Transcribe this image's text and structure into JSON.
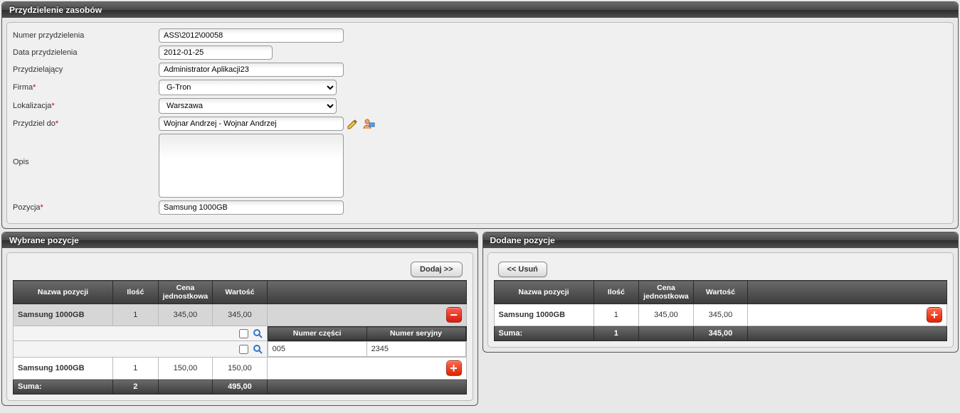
{
  "alloc": {
    "header": "Przydzielenie zasobów",
    "labels": {
      "number": "Numer przydzielenia",
      "date": "Data przydzielenia",
      "assigner": "Przydzielający",
      "company": "Firma",
      "location": "Lokalizacja",
      "assignTo": "Przydziel do",
      "desc": "Opis",
      "position": "Pozycja"
    },
    "values": {
      "number": "ASS\\2012\\00058",
      "date": "2012-01-25",
      "assigner": "Administrator Aplikacji23",
      "company": "G-Tron",
      "location": "Warszawa",
      "assignTo": "Wojnar Andrzej - Wojnar Andrzej",
      "desc": "",
      "position": "Samsung 1000GB"
    }
  },
  "left": {
    "header": "Wybrane pozycje",
    "addBtn": "Dodaj >>",
    "columns": {
      "name": "Nazwa pozycji",
      "qty": "Ilość",
      "unitPrice": "Cena jednostkowa",
      "value": "Wartość"
    },
    "rows": [
      {
        "name": "Samsung 1000GB",
        "qty": "1",
        "unitPrice": "345,00",
        "value": "345,00",
        "action": "minus",
        "selected": true
      },
      {
        "name": "Samsung 1000GB",
        "qty": "1",
        "unitPrice": "150,00",
        "value": "150,00",
        "action": "plus",
        "selected": false
      }
    ],
    "detailCols": {
      "partNo": "Numer części",
      "serialNo": "Numer seryjny"
    },
    "detailRow": {
      "partNo": "005",
      "serialNo": "2345"
    },
    "sum": {
      "label": "Suma:",
      "qty": "2",
      "value": "495,00"
    }
  },
  "right": {
    "header": "Dodane pozycje",
    "removeBtn": "<< Usuń",
    "columns": {
      "name": "Nazwa pozycji",
      "qty": "Ilość",
      "unitPrice": "Cena jednostkowa",
      "value": "Wartość"
    },
    "rows": [
      {
        "name": "Samsung 1000GB",
        "qty": "1",
        "unitPrice": "345,00",
        "value": "345,00",
        "action": "plus"
      }
    ],
    "sum": {
      "label": "Suma:",
      "qty": "1",
      "value": "345,00"
    }
  }
}
